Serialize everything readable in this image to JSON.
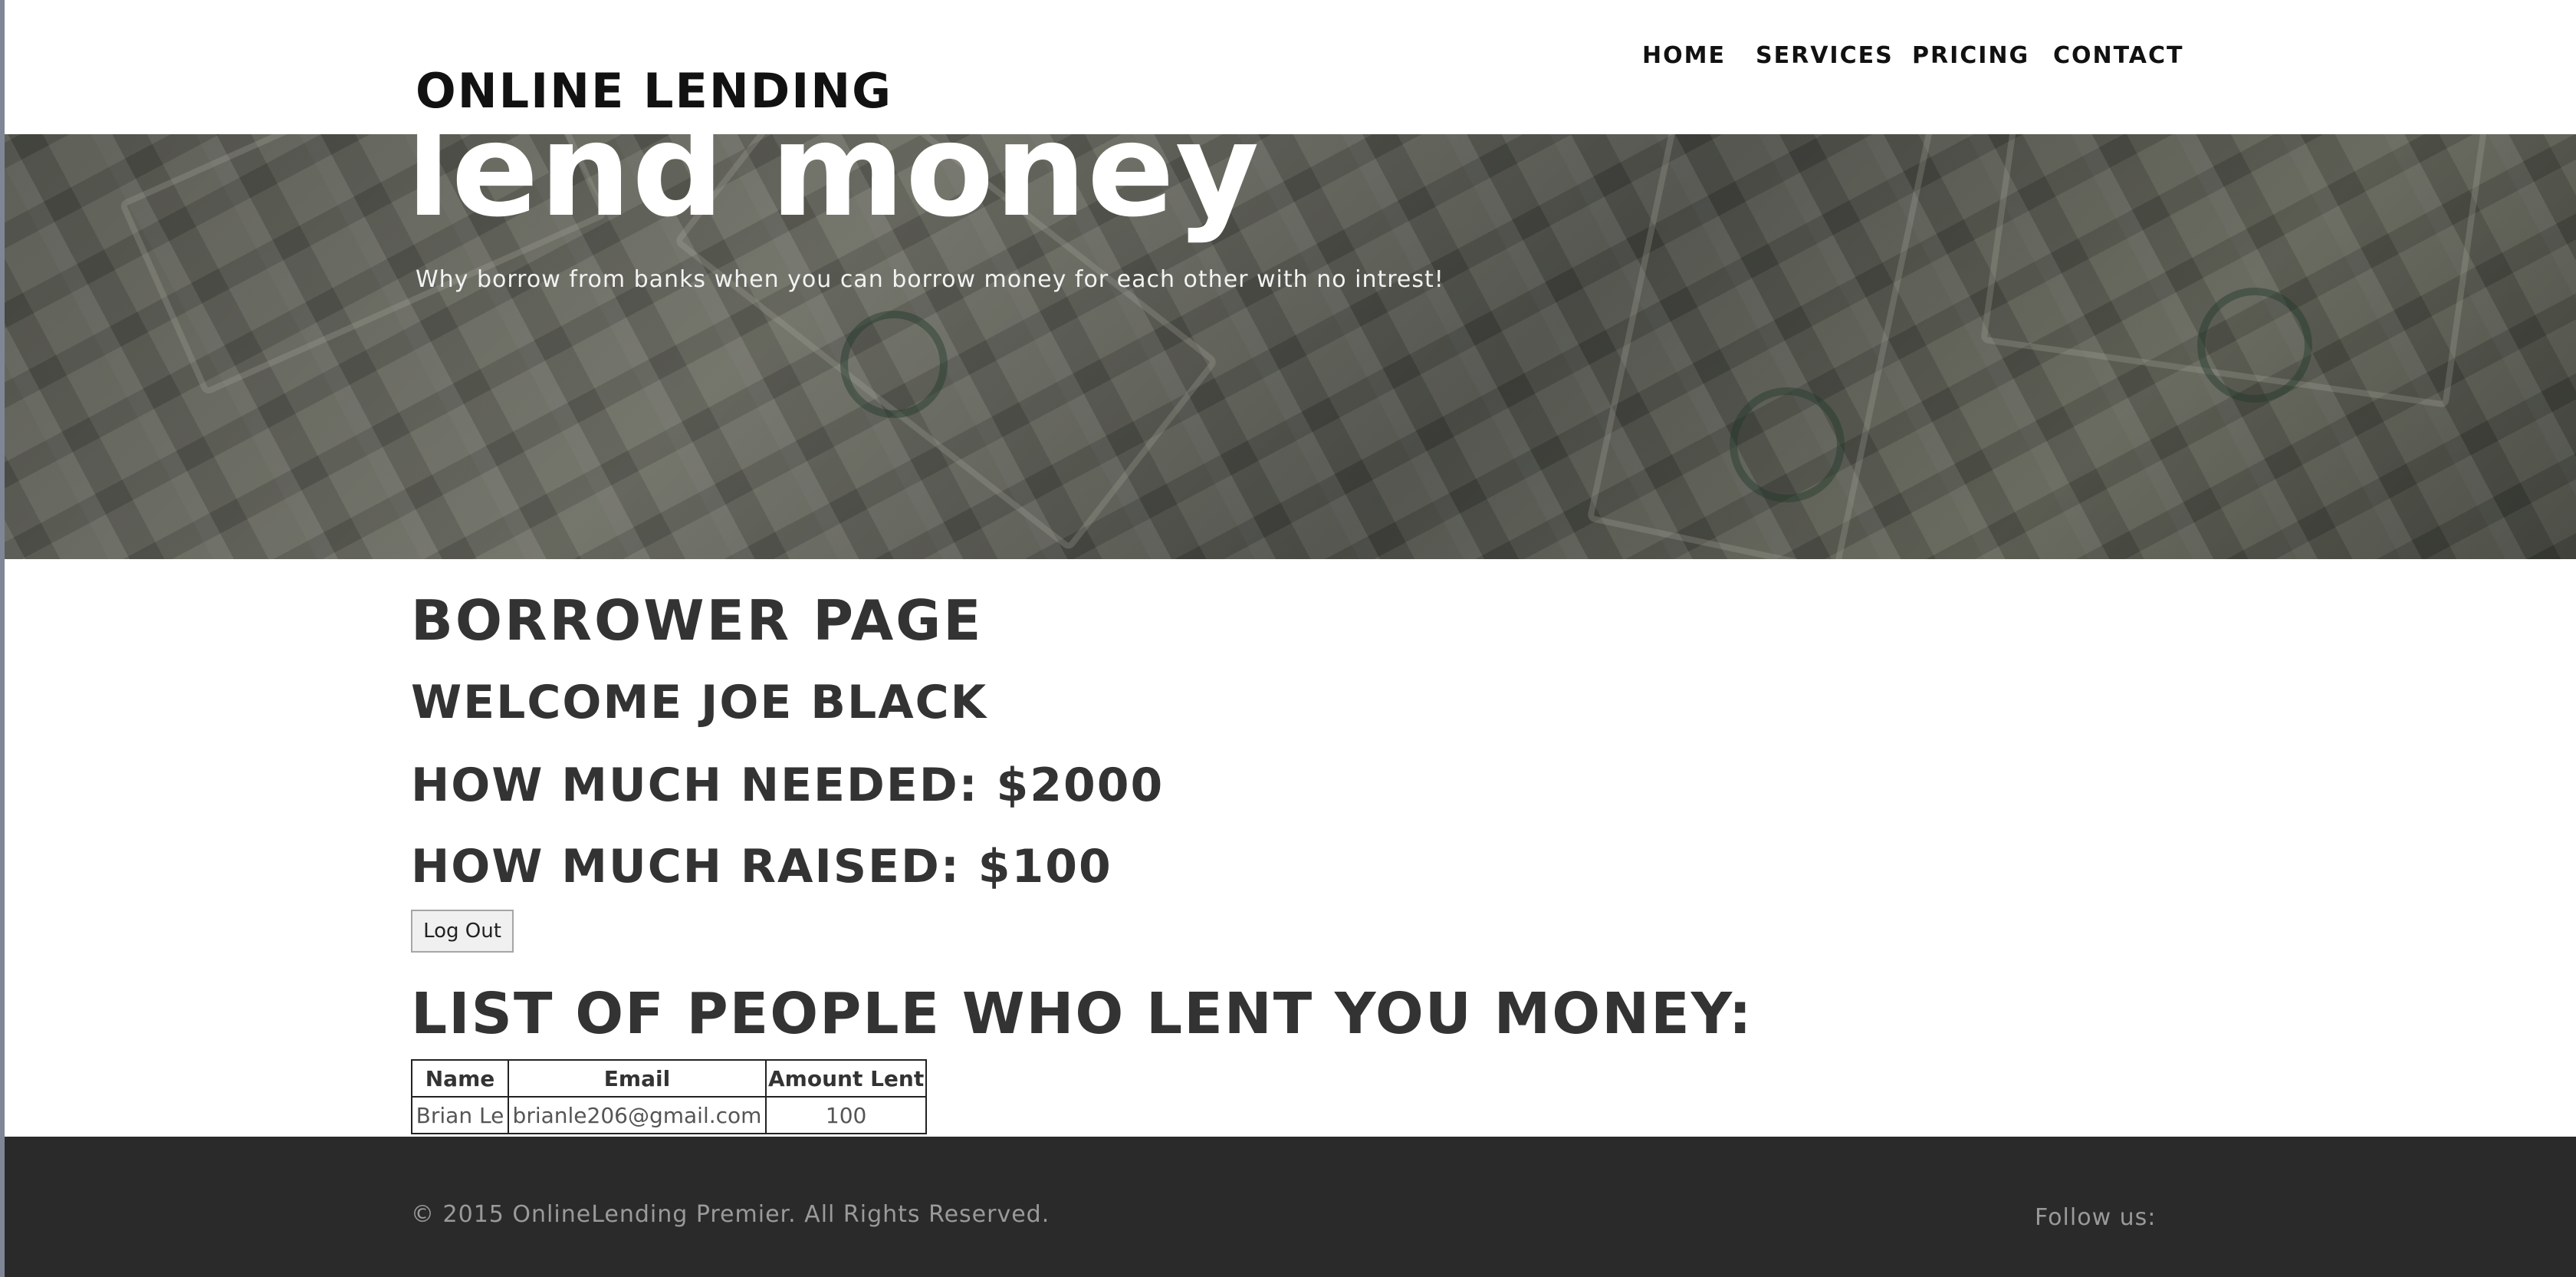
{
  "header": {
    "brand": "ONLINE LENDING",
    "nav": [
      "HOME",
      "SERVICES",
      "PRICING",
      "CONTACT"
    ]
  },
  "hero": {
    "title": "lend money",
    "subtitle": "Why borrow from banks when you can borrow money for each other with no intrest!"
  },
  "main": {
    "page_title": "BORROWER PAGE",
    "welcome": "WELCOME JOE BLACK",
    "needed": "HOW MUCH NEEDED: $2000",
    "raised": "HOW MUCH RAISED: $100",
    "logout_label": "Log Out",
    "list_heading": "LIST OF PEOPLE WHO LENT YOU MONEY:",
    "table": {
      "headers": [
        "Name",
        "Email",
        "Amount Lent"
      ],
      "rows": [
        [
          "Brian Le",
          "brianle206@gmail.com",
          "100"
        ]
      ]
    }
  },
  "footer": {
    "copyright": "© 2015 OnlineLending Premier. All Rights Reserved.",
    "follow": "Follow us:"
  }
}
